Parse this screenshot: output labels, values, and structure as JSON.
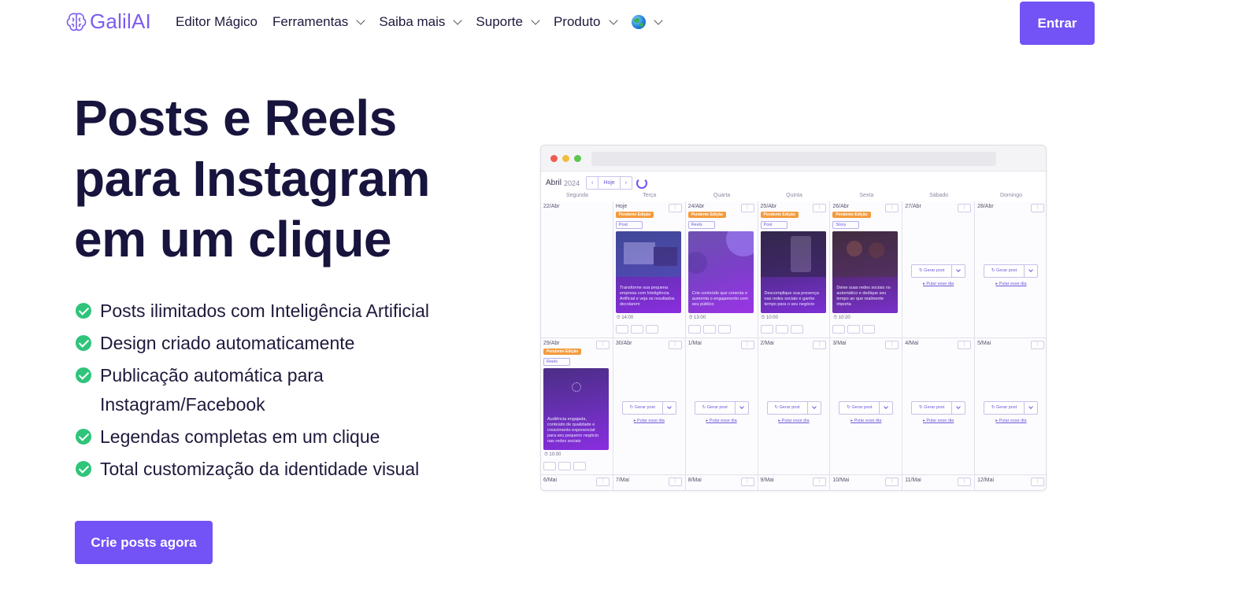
{
  "nav": {
    "logo_text": "GalilAI",
    "items": [
      {
        "label": "Editor Mágico",
        "dropdown": false
      },
      {
        "label": "Ferramentas",
        "dropdown": true
      },
      {
        "label": "Saiba mais",
        "dropdown": true
      },
      {
        "label": "Suporte",
        "dropdown": true
      },
      {
        "label": "Produto",
        "dropdown": true
      }
    ],
    "language_icon": "globe-icon",
    "login_label": "Entrar"
  },
  "hero": {
    "title_line1": "Posts e Reels",
    "title_line2": "para Instagram",
    "title_line3": "em um clique",
    "features": [
      "Posts ilimitados com Inteligência Artificial",
      "Design criado automaticamente",
      "Publicação automática para Instagram/Facebook",
      "Legendas completas em um clique",
      "Total customização da identidade visual"
    ],
    "cta_label": "Crie posts agora"
  },
  "mockup": {
    "month": "Abril",
    "year": "2024",
    "today_label": "Hoje",
    "weekdays": [
      "Segunda",
      "Terça",
      "Quarta",
      "Quinta",
      "Sexta",
      "Sábado",
      "Domingo"
    ],
    "pending_label": "Pendente Edição",
    "generate_label": "Gerar post",
    "skip_label": "Pular esse dia",
    "row1": {
      "days": [
        "22/Abr",
        "Hoje",
        "24/Abr",
        "25/Abr",
        "26/Abr",
        "27/Abr",
        "28/Abr"
      ],
      "posts": [
        {
          "type": "Post",
          "time": "14:00",
          "caption": "Transforme sua pequena empresa com Inteligência Artificial e veja os resultados decolarem"
        },
        {
          "type": "Reels",
          "time": "13:00",
          "caption": "Crie conteúdo que conecta e aumenta o engajamento com seu público"
        },
        {
          "type": "Post",
          "time": "10:00",
          "caption": "Descomplique sua presença nas redes sociais e ganhe tempo para o seu negócio"
        },
        {
          "type": "Story",
          "time": "10:20",
          "caption": "Deixe suas redes sociais no automático e dedique seu tempo ao que realmente importa"
        }
      ]
    },
    "row2": {
      "days": [
        "29/Abr",
        "30/Abr",
        "1/Mai",
        "2/Mai",
        "3/Mai",
        "4/Mai",
        "5/Mai"
      ],
      "post": {
        "type": "Reels",
        "time": "10:00",
        "caption": "Audiência engajada, conteúdo de qualidade e crescimento exponencial para seu pequeno negócio nas redes sociais"
      }
    },
    "row3": {
      "days": [
        "6/Mai",
        "7/Mai",
        "8/Mai",
        "9/Mai",
        "10/Mai",
        "11/Mai",
        "12/Mai"
      ]
    }
  },
  "colors": {
    "brand": "#7352f6",
    "heading": "#17143d",
    "check": "#2fc47a",
    "pending": "#f39b3c"
  }
}
